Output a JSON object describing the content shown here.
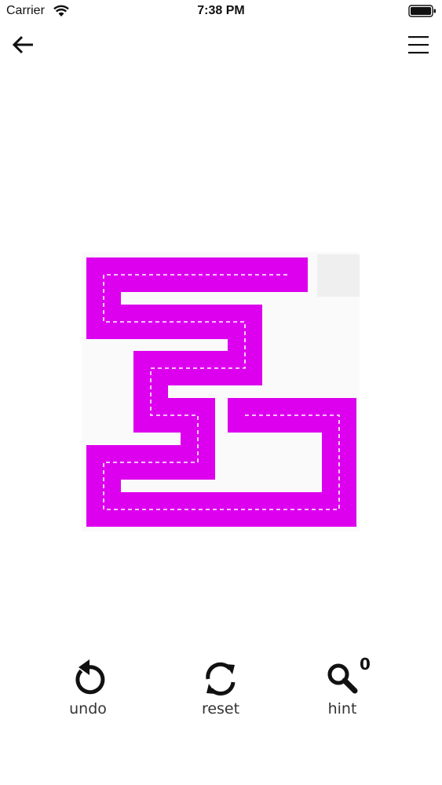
{
  "status_bar": {
    "carrier": "Carrier",
    "time": "7:38 PM"
  },
  "nav": {
    "back_icon": "arrow-left-icon",
    "menu_icon": "hamburger-menu-icon"
  },
  "puzzle": {
    "path_color": "#dd00ee",
    "empty_cell_color": "#f0eff0",
    "dash_color": "#ffffff"
  },
  "controls": {
    "undo_label": "undo",
    "reset_label": "reset",
    "hint_label": "hint",
    "hint_count": "0"
  }
}
